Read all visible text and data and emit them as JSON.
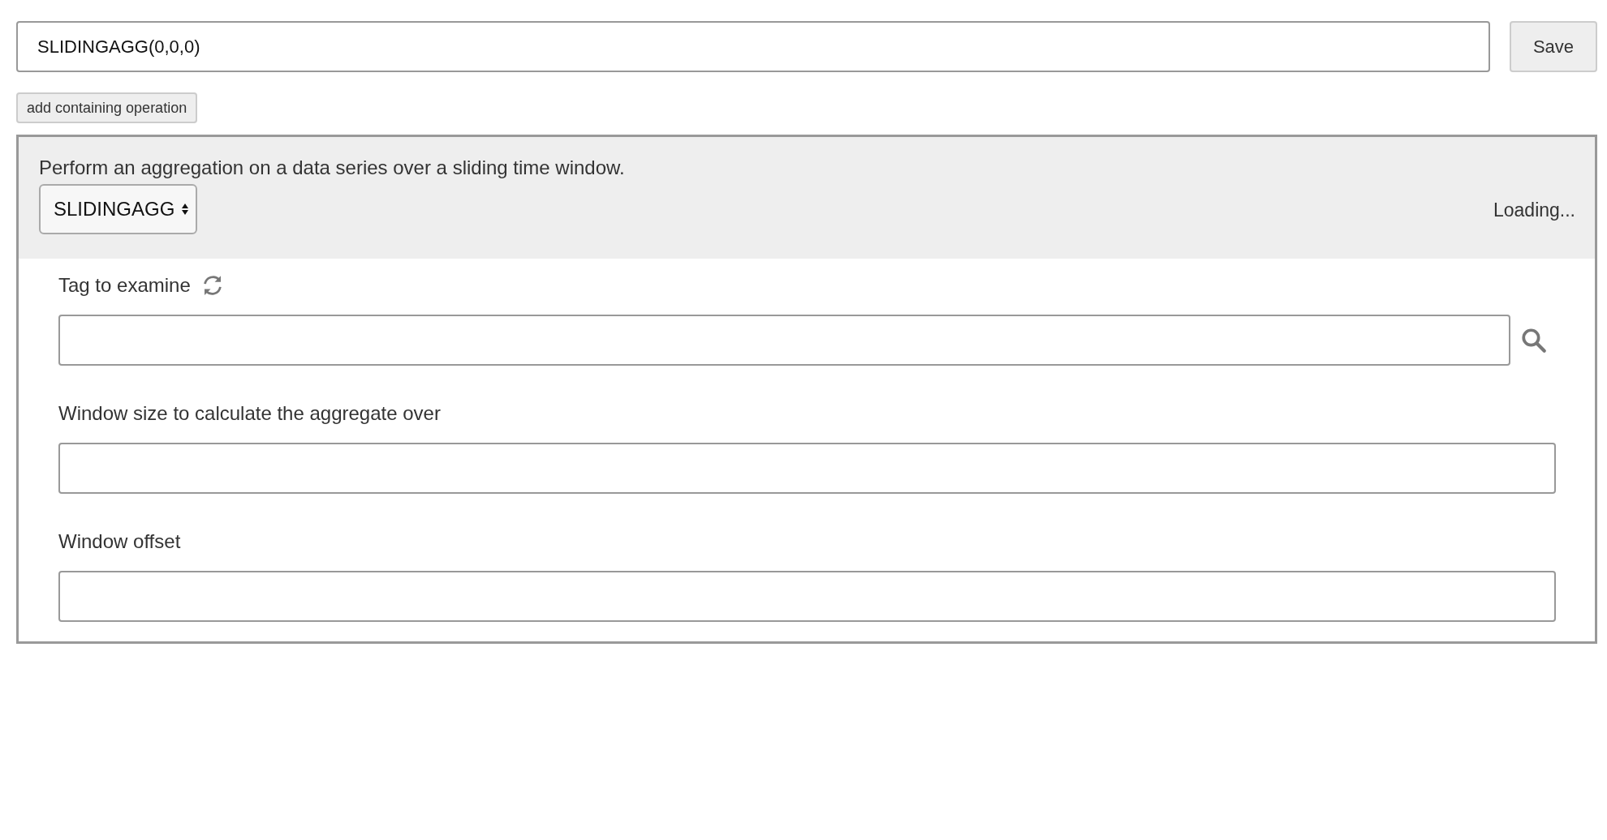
{
  "expression": {
    "value": "SLIDINGAGG(0,0,0)"
  },
  "save_button": "Save",
  "add_button": "add containing operation",
  "operation": {
    "description": "Perform an aggregation on a data series over a sliding time window.",
    "selected_operation": "SLIDINGAGG",
    "status": "Loading..."
  },
  "fields": [
    {
      "kind": "tag",
      "label": "Tag to examine"
    },
    {
      "kind": "text",
      "label": "Window size to calculate the aggregate over"
    },
    {
      "kind": "text",
      "label": "Window offset"
    }
  ]
}
